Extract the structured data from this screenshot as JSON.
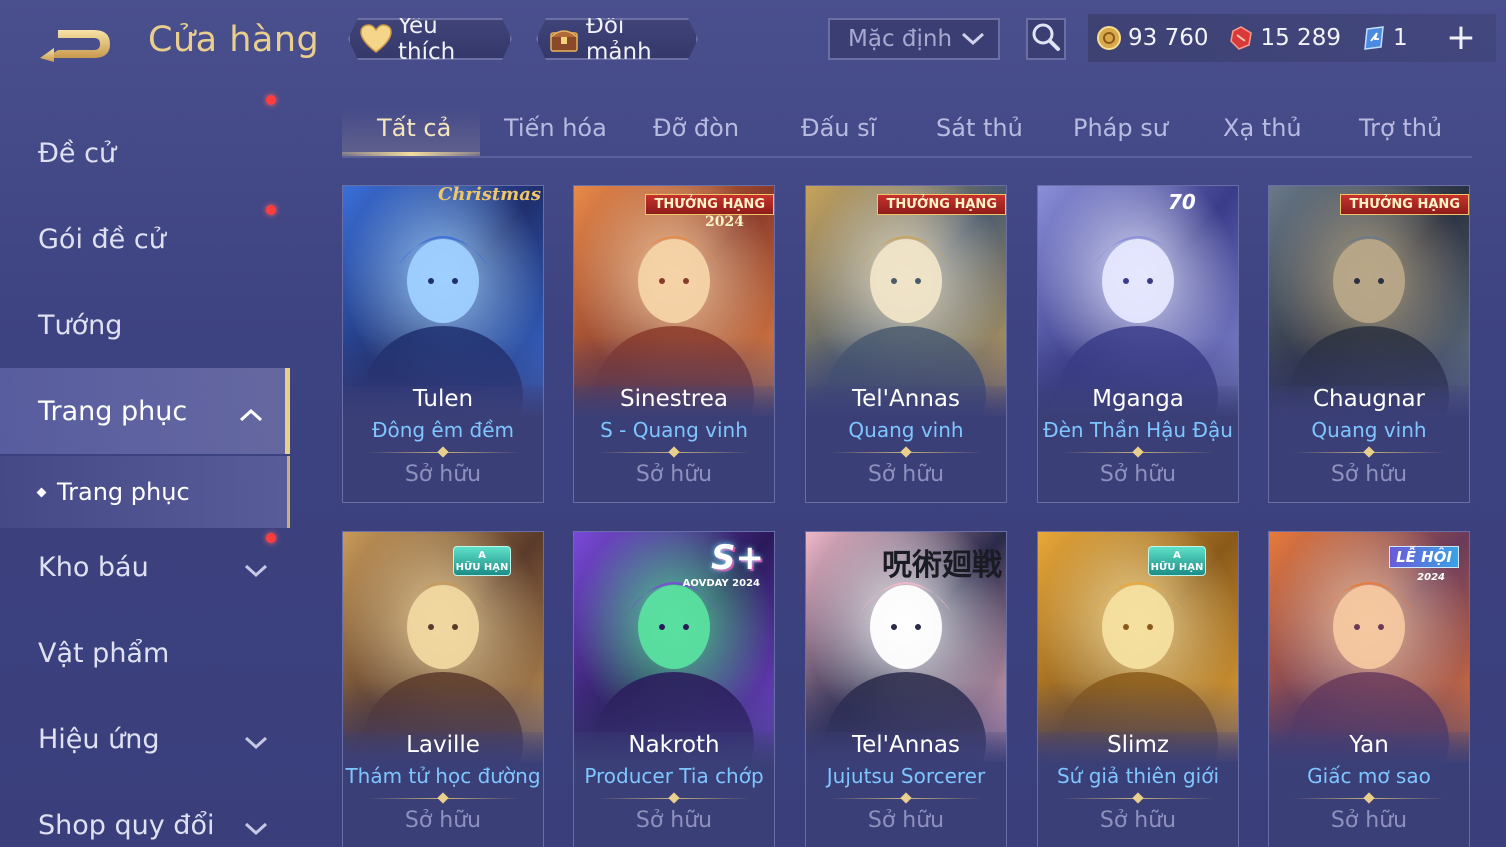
{
  "header": {
    "title": "Cửa hàng",
    "favorite_label": "Yêu thích",
    "fragment_label": "Đổi mảnh",
    "sort_value": "Mặc định",
    "currencies": [
      {
        "icon": "gold-coin-icon",
        "value": "93 760"
      },
      {
        "icon": "red-voucher-icon",
        "value": "15 289"
      },
      {
        "icon": "blue-ticket-icon",
        "value": "1"
      }
    ]
  },
  "sidebar": {
    "items": [
      {
        "label": "Đề cử"
      },
      {
        "label": "Gói đề cử"
      },
      {
        "label": "Tướng"
      },
      {
        "label": "Trang phục"
      },
      {
        "label": "Kho báu"
      },
      {
        "label": "Vật phẩm"
      },
      {
        "label": "Hiệu ứng"
      },
      {
        "label": "Shop quy đổi"
      }
    ],
    "sub_item": "Trang phục"
  },
  "tabs": [
    "Tất cả",
    "Tiến hóa",
    "Đỡ đòn",
    "Đấu sĩ",
    "Sát thủ",
    "Pháp sư",
    "Xạ thủ",
    "Trợ thủ"
  ],
  "cards": [
    {
      "hero": "Tulen",
      "skin": "Đông êm đềm",
      "status": "Sở hữu",
      "badge": "Christmas",
      "colors": [
        "#3a6fd8",
        "#9fd0ff",
        "#1f2f6e"
      ]
    },
    {
      "hero": "Sinestrea",
      "skin": "S - Quang vinh",
      "status": "Sở hữu",
      "badge": "THƯỞNG HẠNG",
      "badge_year": "2024",
      "colors": [
        "#e88a4a",
        "#f6d3a8",
        "#8a3a2a"
      ]
    },
    {
      "hero": "Tel'Annas",
      "skin": "Quang vinh",
      "status": "Sở hữu",
      "badge": "THƯỞNG HẠNG",
      "colors": [
        "#c9a45a",
        "#f0e4c8",
        "#4a5a6e"
      ]
    },
    {
      "hero": "Mganga",
      "skin": "Đèn Thần Hậu Đậu",
      "status": "Sở hữu",
      "badge_num": "70",
      "colors": [
        "#8b8fd8",
        "#e6e8ff",
        "#3a3c8a"
      ]
    },
    {
      "hero": "Chaugnar",
      "skin": "Quang vinh",
      "status": "Sở hữu",
      "badge": "THƯỞNG HẠNG",
      "colors": [
        "#6a7a8a",
        "#b8a888",
        "#2a3040"
      ]
    },
    {
      "hero": "Laville",
      "skin": "Thám tử học đường",
      "status": "Sở hữu",
      "badge_a": "A",
      "badge_a_sub": "HỮU HẠN",
      "colors": [
        "#c89a5a",
        "#f0d8a0",
        "#5a3a2a"
      ]
    },
    {
      "hero": "Nakroth",
      "skin": "Producer Tia chớp",
      "status": "Sở hữu",
      "badge_s": "S+",
      "badge_s_sub": "AOVDAY 2024",
      "colors": [
        "#7a4ad8",
        "#5ae0a0",
        "#2a1a5a"
      ]
    },
    {
      "hero": "Tel'Annas",
      "skin": "Jujutsu Sorcerer",
      "status": "Sở hữu",
      "badge_jp": "呪術廻戦",
      "colors": [
        "#f0b8c8",
        "#ffffff",
        "#2a2a4a"
      ]
    },
    {
      "hero": "Slimz",
      "skin": "Sứ giả thiên giới",
      "status": "Sở hữu",
      "badge_a": "A",
      "badge_a_sub": "HỮU HẠN",
      "colors": [
        "#e8a83a",
        "#f6e0a0",
        "#8a5a1a"
      ]
    },
    {
      "hero": "Yan",
      "skin": "Giấc mơ sao",
      "status": "Sở hữu",
      "badge_le": "LỄ HỘI",
      "badge_le_sub": "2024",
      "colors": [
        "#e87a3a",
        "#f6c8a0",
        "#6a3a5a"
      ]
    }
  ]
}
